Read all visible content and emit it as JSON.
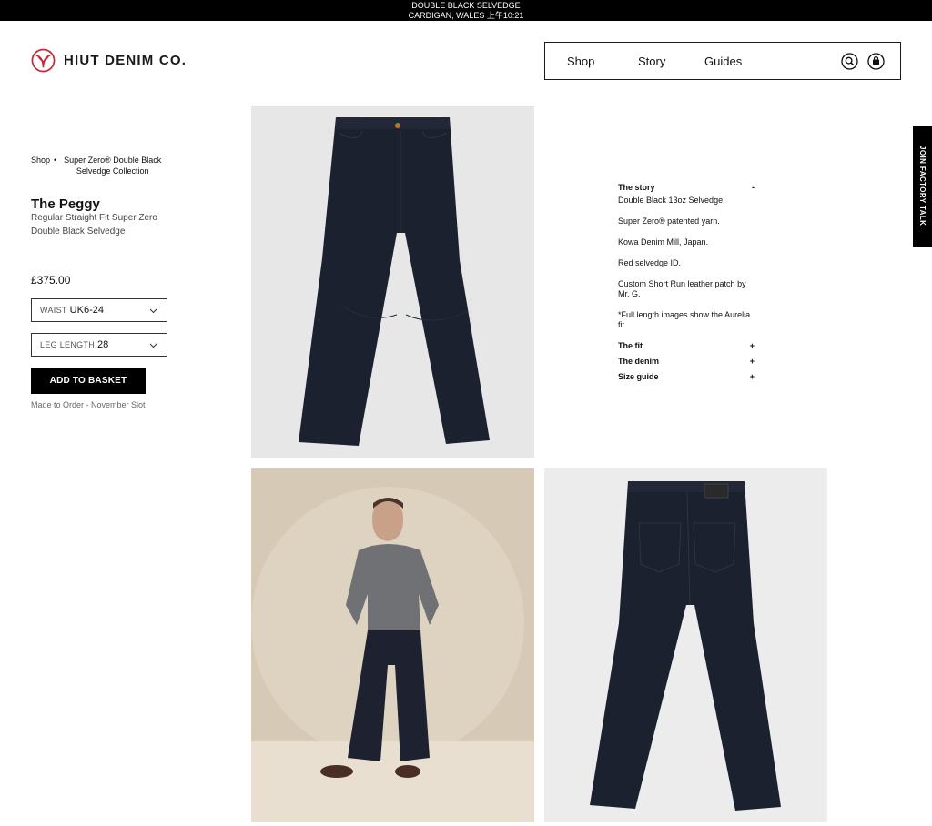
{
  "announcement": {
    "line1": "DOUBLE BLACK SELVEDGE",
    "line2": "CARDIGAN, WALES 上午10:21"
  },
  "brand": {
    "name": "HIUT DENIM CO.",
    "logo_icon": "hiut-owl-logo-icon",
    "accent_color": "#c8283a"
  },
  "nav": {
    "items": [
      {
        "label": "Shop"
      },
      {
        "label": "Story"
      },
      {
        "label": "Guides"
      }
    ],
    "search_icon": "search-icon",
    "basket_icon": "basket-icon"
  },
  "breadcrumb": {
    "shop": "Shop",
    "separator": "•",
    "collection": "Super Zero® Double Black Selvedge Collection"
  },
  "product": {
    "title": "The Peggy",
    "subtitle": "Regular Straight Fit Super Zero Double Black Selvedge",
    "price": "£375.00",
    "waist": {
      "label": "WAIST",
      "value": "UK6-24"
    },
    "leg": {
      "label": "LEG LENGTH",
      "value": "28"
    },
    "add_button": "ADD TO BASKET",
    "availability": "Made to Order - November Slot"
  },
  "details": {
    "story": {
      "title": "The story",
      "symbol": "-",
      "lines": [
        "Double Black 13oz Selvedge.",
        "Super Zero® patented yarn.",
        "Kowa Denim Mill, Japan.",
        "Red selvedge ID.",
        "Custom Short Run leather patch by Mr. G.",
        "*Full length images show the Aurelia fit."
      ]
    },
    "fit": {
      "title": "The fit",
      "symbol": "+"
    },
    "denim": {
      "title": "The denim",
      "symbol": "+"
    },
    "size_guide": {
      "title": "Size guide",
      "symbol": "+"
    }
  },
  "side_tab": {
    "label": "JOIN FACTORY TALK."
  },
  "colors": {
    "denim": "#1c2130",
    "background": "#ffffff",
    "black": "#000000"
  }
}
